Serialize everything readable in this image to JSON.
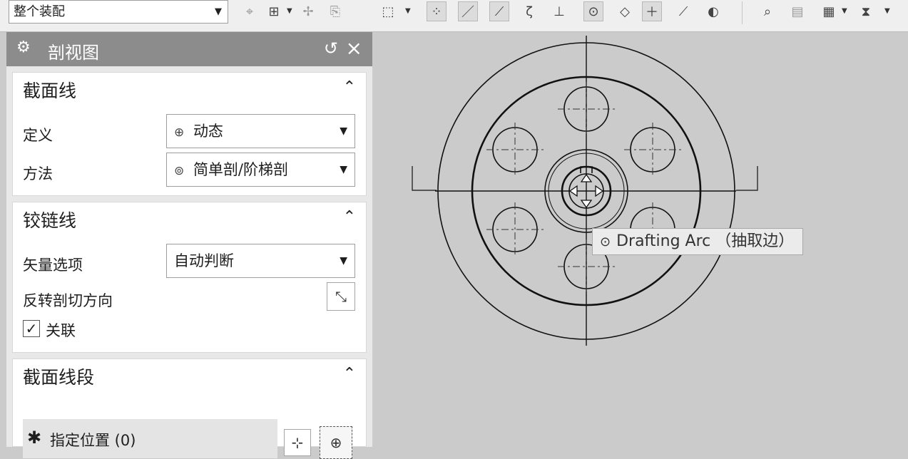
{
  "toolbar": {
    "filter_value": "整个装配",
    "icons": [
      "snap-point-icon",
      "add-point-icon",
      "point-options-icon",
      "copy-icon",
      "rectangle-select-icon",
      "selection-mode-icon",
      "line-icon",
      "end-point-icon",
      "arc-icon",
      "center-point-icon",
      "circle-center-icon",
      "quadrant-icon",
      "intersection-icon",
      "existing-point-icon",
      "tangent-icon",
      "view-icon",
      "display-icon",
      "layer-icon",
      "filter-icon"
    ]
  },
  "panel": {
    "title": "剖视图",
    "section_line": {
      "header": "截面线",
      "define_label": "定义",
      "define_value": "动态",
      "method_label": "方法",
      "method_value": "简单剖/阶梯剖"
    },
    "hinge_line": {
      "header": "铰链线",
      "vector_label": "矢量选项",
      "vector_value": "自动判断",
      "reverse_label": "反转剖切方向",
      "associate_label": "关联",
      "associate_checked": true
    },
    "section_segments": {
      "header": "截面线段",
      "specify_label": "指定位置 (0)"
    }
  },
  "canvas": {
    "tooltip": "Drafting Arc （抽取边）"
  }
}
